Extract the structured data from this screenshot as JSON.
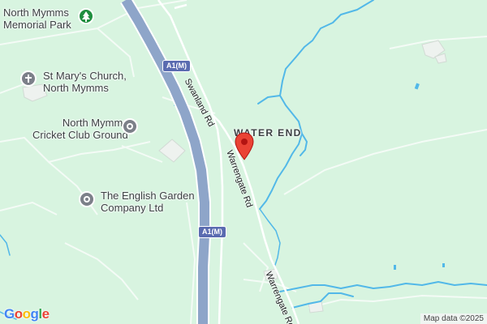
{
  "map": {
    "attribution": "Map data ©2025",
    "logo": "Google",
    "logo_letters": [
      {
        "ch": "G",
        "color": "#4285f4"
      },
      {
        "ch": "o",
        "color": "#ea4335"
      },
      {
        "ch": "o",
        "color": "#fbbc05"
      },
      {
        "ch": "g",
        "color": "#4285f4"
      },
      {
        "ch": "l",
        "color": "#34a853"
      },
      {
        "ch": "e",
        "color": "#ea4335"
      }
    ],
    "colors": {
      "land": "#d8f4e0",
      "motorway": "#8ea5c9",
      "water": "#52b8e8",
      "minor_road": "#ffffff",
      "marker": "#ea4335"
    },
    "labels": {
      "memorial_park": "North Mymms\nMemorial Park",
      "church": "St Mary's Church,\nNorth Mymms",
      "cricket": "North Mymms\nCricket Club Ground",
      "garden": "The English Garden\nCompany Ltd",
      "place": "WATER END"
    },
    "roads": {
      "swanland": "Swanland Rd",
      "warrengate_1": "Warrengate Rd",
      "warrengate_2": "Warrengate Rd"
    },
    "shields": {
      "a1m_top": "A1(M)",
      "a1m_mid": "A1(M)"
    },
    "icons": {
      "memorial_park": "tree-icon",
      "church": "cross-icon",
      "cricket": "landmark-icon",
      "garden": "landmark-icon",
      "marker": "map-pin-icon"
    }
  }
}
